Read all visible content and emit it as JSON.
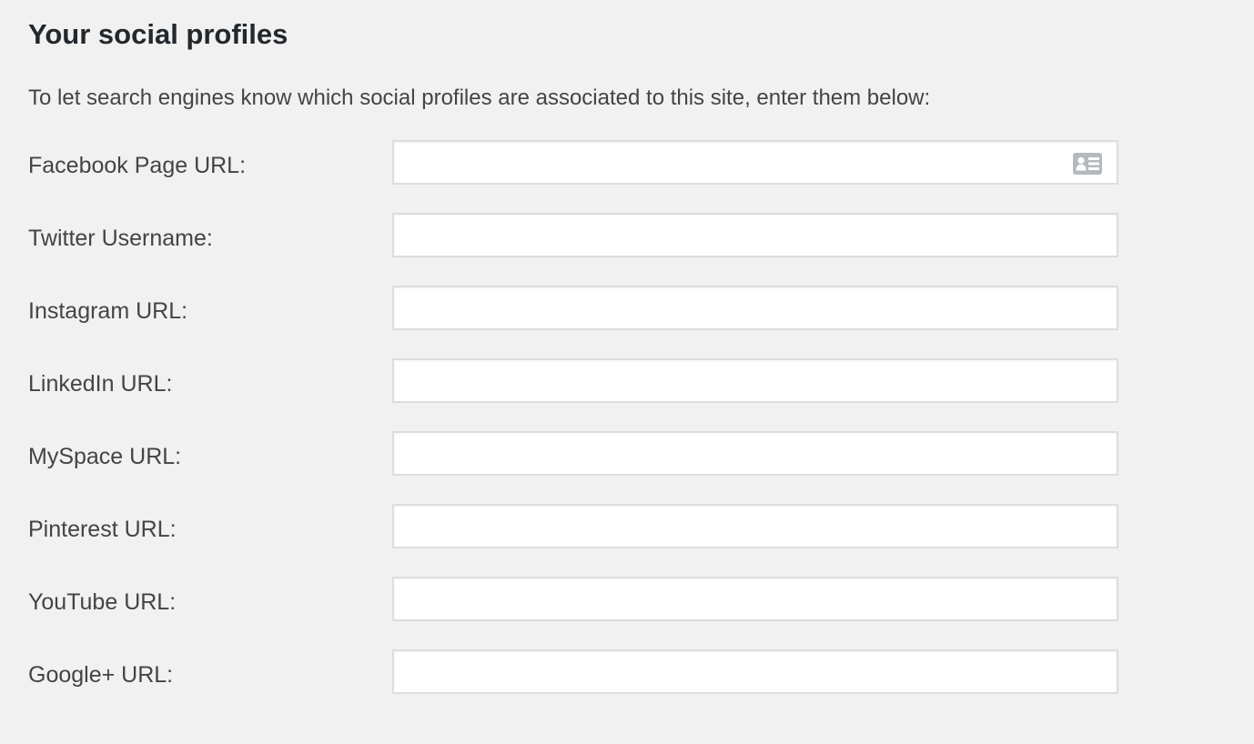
{
  "section": {
    "title": "Your social profiles",
    "intro": "To let search engines know which social profiles are associated to this site, enter them below:"
  },
  "fields": [
    {
      "label": "Facebook Page URL:",
      "value": "",
      "placeholder": "",
      "icon": "contact-card-icon"
    },
    {
      "label": "Twitter Username:",
      "value": "",
      "placeholder": ""
    },
    {
      "label": "Instagram URL:",
      "value": "",
      "placeholder": ""
    },
    {
      "label": "LinkedIn URL:",
      "value": "",
      "placeholder": ""
    },
    {
      "label": "MySpace URL:",
      "value": "",
      "placeholder": ""
    },
    {
      "label": "Pinterest URL:",
      "value": "",
      "placeholder": ""
    },
    {
      "label": "YouTube URL:",
      "value": "",
      "placeholder": ""
    },
    {
      "label": "Google+ URL:",
      "value": "",
      "placeholder": ""
    }
  ],
  "colors": {
    "background": "#f1f1f1",
    "input_background": "#ffffff",
    "input_border": "#dddddd",
    "icon": "#b4b9be"
  }
}
